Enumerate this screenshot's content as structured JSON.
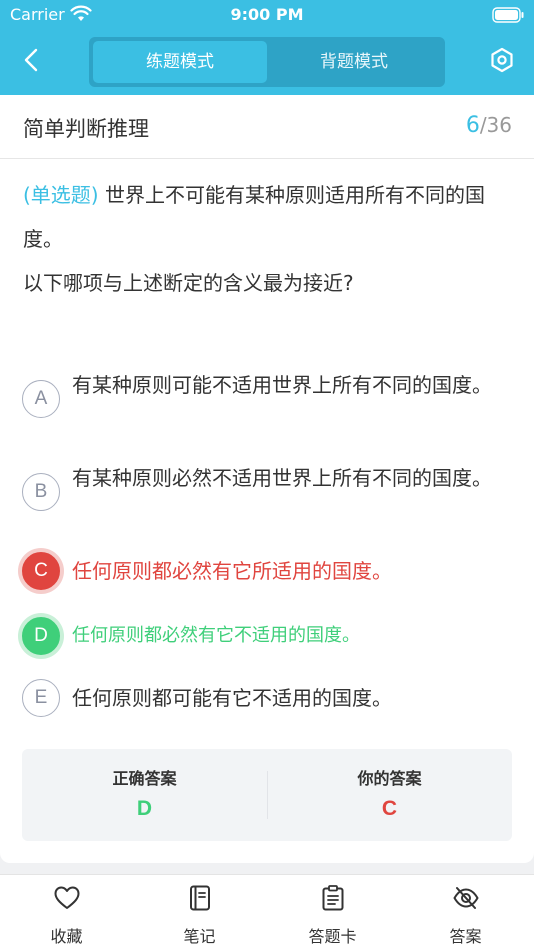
{
  "status_bar": {
    "carrier": "Carrier",
    "time": "9:00 PM"
  },
  "nav": {
    "tabs": [
      {
        "label": "练题模式",
        "active": true
      },
      {
        "label": "背题模式",
        "active": false
      }
    ]
  },
  "card": {
    "section_title": "简单判断推理",
    "progress_current": "6",
    "progress_total": "/36"
  },
  "question": {
    "type_label": "(单选题)",
    "text_line1": " 世界上不可能有某种原则适用所有不同的国度。",
    "text_line2": "以下哪项与上述断定的含义最为接近?"
  },
  "options": [
    {
      "letter": "A",
      "text": "有某种原则可能不适用世界上所有不同的国度。",
      "state": "normal"
    },
    {
      "letter": "B",
      "text": "有某种原则必然不适用世界上所有不同的国度。",
      "state": "normal"
    },
    {
      "letter": "C",
      "text": "任何原则都必然有它所适用的国度。",
      "state": "wrong"
    },
    {
      "letter": "D",
      "text": "任何原则都必然有它不适用的国度。",
      "state": "right"
    },
    {
      "letter": "E",
      "text": "任何原则都可能有它不适用的国度。",
      "state": "normal"
    }
  ],
  "answer": {
    "correct_label": "正确答案",
    "correct_value": "D",
    "mine_label": "你的答案",
    "mine_value": "C"
  },
  "toolbar": {
    "items": [
      {
        "label": "收藏",
        "icon": "heart-icon"
      },
      {
        "label": "笔记",
        "icon": "notebook-icon"
      },
      {
        "label": "答题卡",
        "icon": "clipboard-icon"
      },
      {
        "label": "答案",
        "icon": "eye-off-icon"
      }
    ]
  },
  "colors": {
    "accent": "#3bbfe3",
    "correct": "#3fcf7a",
    "wrong": "#e0453f"
  }
}
